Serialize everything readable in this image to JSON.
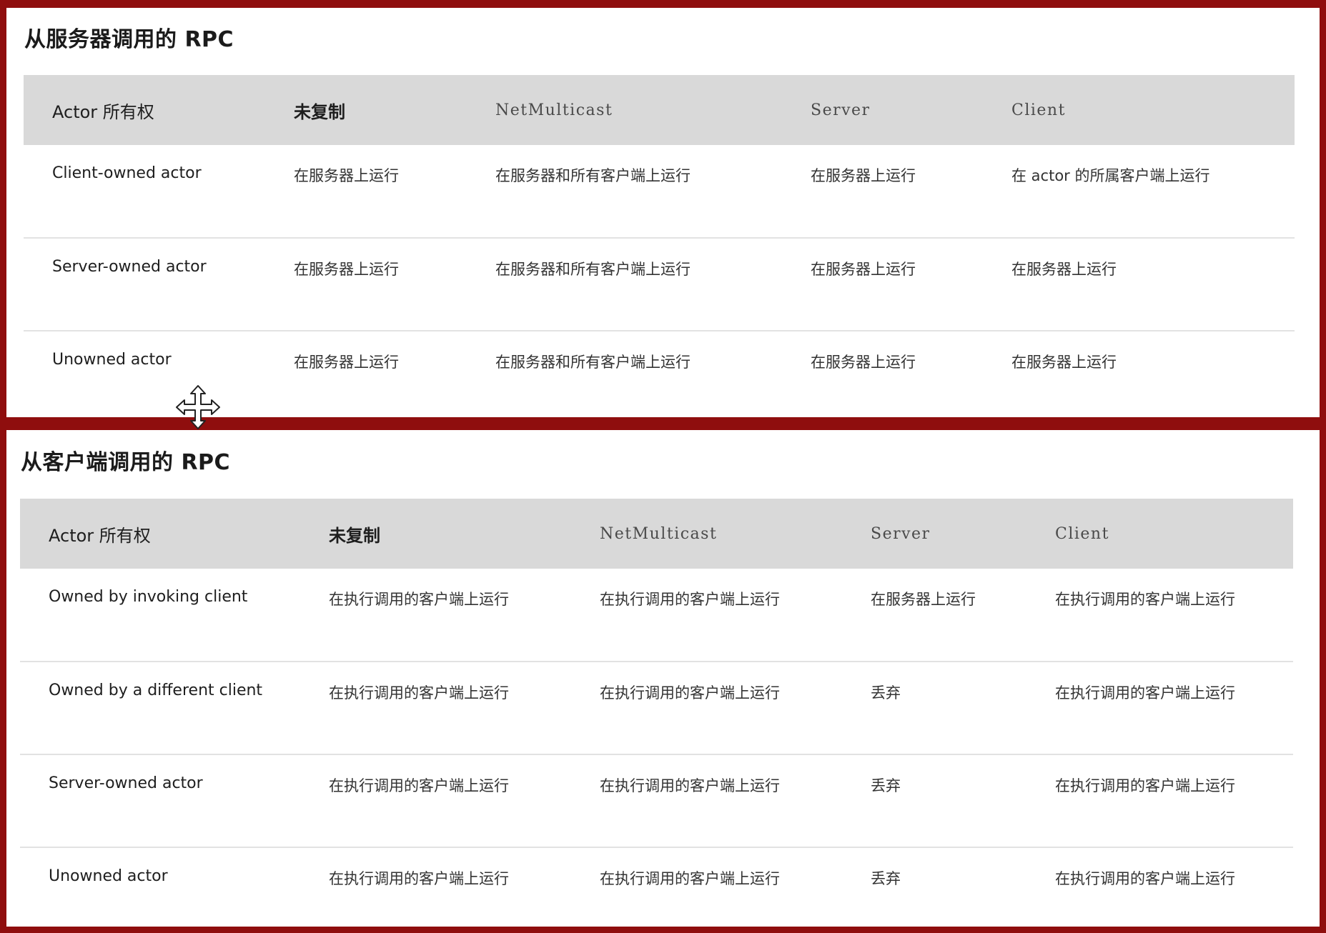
{
  "server_section": {
    "title": "从服务器调用的 RPC",
    "headers": [
      "Actor 所有权",
      "未复制",
      "NetMulticast",
      "Server",
      "Client"
    ],
    "rows": [
      [
        "Client-owned actor",
        "在服务器上运行",
        "在服务器和所有客户端上运行",
        "在服务器上运行",
        "在 actor 的所属客户端上运行"
      ],
      [
        "Server-owned actor",
        "在服务器上运行",
        "在服务器和所有客户端上运行",
        "在服务器上运行",
        "在服务器上运行"
      ],
      [
        "Unowned actor",
        "在服务器上运行",
        "在服务器和所有客户端上运行",
        "在服务器上运行",
        "在服务器上运行"
      ]
    ]
  },
  "client_section": {
    "title": "从客户端调用的 RPC",
    "headers": [
      "Actor 所有权",
      "未复制",
      "NetMulticast",
      "Server",
      "Client"
    ],
    "rows": [
      [
        "Owned by invoking client",
        "在执行调用的客户端上运行",
        "在执行调用的客户端上运行",
        "在服务器上运行",
        "在执行调用的客户端上运行"
      ],
      [
        "Owned by a different client",
        "在执行调用的客户端上运行",
        "在执行调用的客户端上运行",
        "丢弃",
        "在执行调用的客户端上运行"
      ],
      [
        "Server-owned actor",
        "在执行调用的客户端上运行",
        "在执行调用的客户端上运行",
        "丢弃",
        "在执行调用的客户端上运行"
      ],
      [
        "Unowned actor",
        "在执行调用的客户端上运行",
        "在执行调用的客户端上运行",
        "丢弃",
        "在执行调用的客户端上运行"
      ]
    ]
  },
  "cursor": {
    "icon": "move-cursor-icon"
  },
  "colors": {
    "frame": "#8f0e0e",
    "header_background": "#d9d9d9",
    "row_divider": "#e2e2e2"
  }
}
